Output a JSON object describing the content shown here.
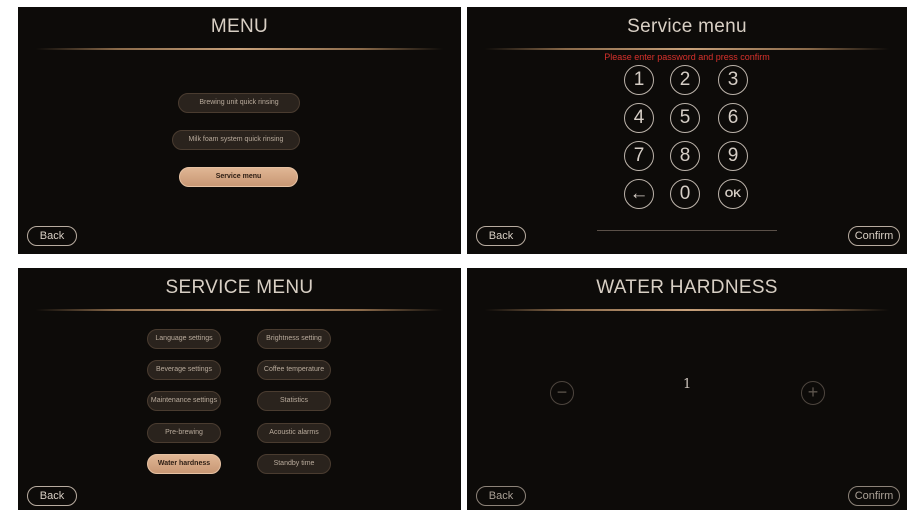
{
  "menu_screen": {
    "title": "MENU",
    "items": [
      {
        "label": "Brewing unit quick rinsing"
      },
      {
        "label": "Milk foam system quick rinsing"
      },
      {
        "label": "Service menu",
        "selected": true
      }
    ],
    "back_label": "Back"
  },
  "password_screen": {
    "title": "Service menu",
    "prompt": "Please enter password and press confirm",
    "keys": [
      "1",
      "2",
      "3",
      "4",
      "5",
      "6",
      "7",
      "8",
      "9",
      "←",
      "0",
      "OK"
    ],
    "back_label": "Back",
    "confirm_label": "Confirm"
  },
  "service_menu_screen": {
    "title": "SERVICE MENU",
    "left_items": [
      {
        "label": "Language settings"
      },
      {
        "label": "Beverage settings"
      },
      {
        "label": "Maintenance settings"
      },
      {
        "label": "Pre-brewing"
      },
      {
        "label": "Water hardness",
        "selected": true
      }
    ],
    "right_items": [
      {
        "label": "Brightness setting"
      },
      {
        "label": "Coffee temperature"
      },
      {
        "label": "Statistics"
      },
      {
        "label": "Acoustic alarms"
      },
      {
        "label": "Standby time"
      }
    ],
    "back_label": "Back"
  },
  "water_hardness_screen": {
    "title": "WATER HARDNESS",
    "value": "1",
    "minus_symbol": "−",
    "plus_symbol": "+",
    "back_label": "Back",
    "confirm_label": "Confirm"
  },
  "colors": {
    "panel_bg": "#0d0b09",
    "accent": "#d6a887",
    "prompt_red": "#d8312c",
    "text": "#d8cfc4"
  }
}
